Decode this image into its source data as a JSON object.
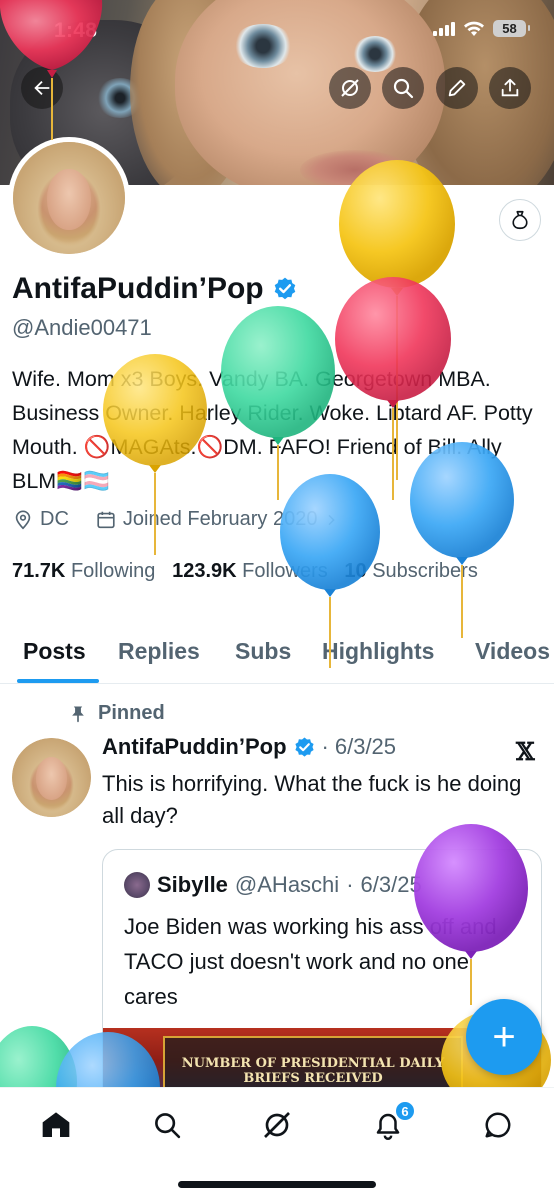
{
  "status_bar": {
    "time": "1:48",
    "battery": "58"
  },
  "profile": {
    "display_name": "AntifaPuddin’Pop",
    "handle": "@Andie00471",
    "bio": "Wife. Mom x3 Boys. Vandy BA. Georgetown MBA. Business Owner. Harley Rider. Woke. Libtard AF. Potty Mouth. 🚫MAGAts.🚫DM. FAFO! Friend of Bill. Ally BLM🏳️‍🌈🏳️‍⚧️",
    "location": "DC",
    "joined": "Joined February 2020",
    "following_count": "71.7K",
    "following_label": "Following",
    "followers_count": "123.9K",
    "followers_label": "Followers",
    "subscribers_count": "10",
    "subscribers_label": "Subscribers"
  },
  "tabs": [
    {
      "label": "Posts",
      "active": true
    },
    {
      "label": "Replies",
      "active": false
    },
    {
      "label": "Subs",
      "active": false
    },
    {
      "label": "Highlights",
      "active": false
    },
    {
      "label": "Videos",
      "active": false
    }
  ],
  "pinned_post": {
    "pinned_label": "Pinned",
    "author": "AntifaPuddin’Pop",
    "date": "6/3/25",
    "text": "This is horrifying. What the fuck is he doing all day?",
    "quote": {
      "author": "Sibylle",
      "handle": "@AHaschi",
      "date": "6/3/25",
      "text": "Joe Biden was working his ass off and TACO just doesn't work and no one cares",
      "image_caption": "NUMBER OF PRESIDENTIAL DAILY BRIEFS RECEIVED"
    }
  },
  "fab": {
    "label": "+"
  },
  "bottom_nav": {
    "items": [
      "home-icon",
      "search-icon",
      "grok-icon",
      "notifications-icon",
      "messages-icon"
    ],
    "notifications_badge": "6"
  },
  "colors": {
    "accent": "#1d9bf0",
    "text": "#0f1419",
    "muted": "#536471",
    "balloon_yellow": "#f5c518",
    "balloon_red": "#f0365a",
    "balloon_green": "#3ed9a0",
    "balloon_blue": "#3aa7f5",
    "balloon_purple": "#a23ee0"
  }
}
